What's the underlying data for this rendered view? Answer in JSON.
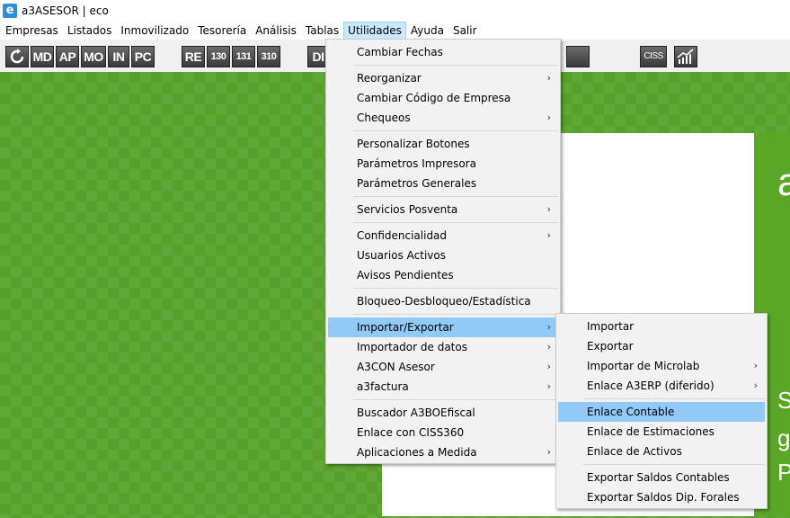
{
  "window": {
    "title": "a3ASESOR | eco",
    "icon": "e"
  },
  "menubar": [
    "Empresas",
    "Listados",
    "Inmovilizado",
    "Tesorería",
    "Análisis",
    "Tablas",
    "Utilidades",
    "Ayuda",
    "Salir"
  ],
  "toolbar": {
    "buttons": [
      "MD",
      "AP",
      "MO",
      "IN",
      "PC",
      "RE",
      "130",
      "131",
      "310",
      "DI",
      "CISS"
    ]
  },
  "utilidades_menu": {
    "items": [
      {
        "label": "Cambiar Fechas",
        "submenu": false
      },
      {
        "label": "Reorganizar",
        "submenu": true
      },
      {
        "label": "Cambiar Código de Empresa",
        "submenu": false
      },
      {
        "label": "Chequeos",
        "submenu": true
      },
      {
        "label": "Personalizar Botones",
        "submenu": false
      },
      {
        "label": "Parámetros Impresora",
        "submenu": false
      },
      {
        "label": "Parámetros Generales",
        "submenu": false
      },
      {
        "label": "Servicios Posventa",
        "submenu": true
      },
      {
        "label": "Confidencialidad",
        "submenu": true
      },
      {
        "label": "Usuarios Activos",
        "submenu": false
      },
      {
        "label": "Avisos Pendientes",
        "submenu": false
      },
      {
        "label": "Bloqueo-Desbloqueo/Estadística",
        "submenu": false
      },
      {
        "label": "Importar/Exportar",
        "submenu": true
      },
      {
        "label": "Importador de datos",
        "submenu": true
      },
      {
        "label": "A3CON Asesor",
        "submenu": true
      },
      {
        "label": "a3factura",
        "submenu": true
      },
      {
        "label": "Buscador A3BOEfiscal",
        "submenu": false
      },
      {
        "label": "Enlace con CISS360",
        "submenu": false
      },
      {
        "label": "Aplicaciones a Medida",
        "submenu": true
      }
    ]
  },
  "importar_exportar_menu": {
    "items": [
      {
        "label": "Importar",
        "submenu": false
      },
      {
        "label": "Exportar",
        "submenu": false
      },
      {
        "label": "Importar de Microlab",
        "submenu": true
      },
      {
        "label": "Enlace A3ERP (diferido)",
        "submenu": true
      },
      {
        "label": "Enlace Contable",
        "submenu": false
      },
      {
        "label": "Enlace de Estimaciones",
        "submenu": false
      },
      {
        "label": "Enlace de Activos",
        "submenu": false
      },
      {
        "label": "Exportar Saldos Contables",
        "submenu": false
      },
      {
        "label": "Exportar Saldos Dip. Forales",
        "submenu": false
      }
    ]
  },
  "submenu_arrow": "›",
  "background_panel": {
    "letters": [
      "a",
      "S",
      "g",
      "P"
    ]
  },
  "colors": {
    "highlight": "#91c9f7",
    "menu_active": "#cce8ff",
    "desktop_green": "#55a12a"
  }
}
